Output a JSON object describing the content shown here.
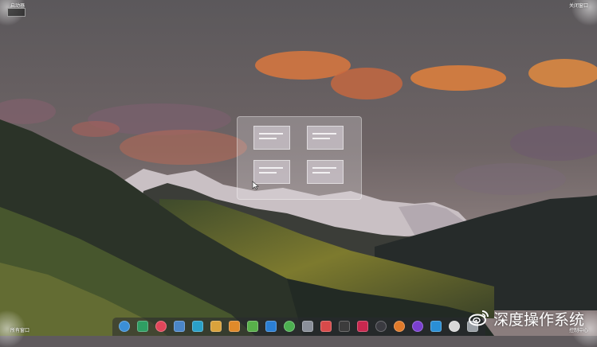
{
  "corners": {
    "top_left": "启动器",
    "top_right": "关闭窗口",
    "bottom_left": "所有窗口",
    "bottom_right": "控制中心"
  },
  "watermark": {
    "text": "深度操作系统"
  },
  "dock": {
    "icons": [
      {
        "name": "launcher-icon",
        "color": "#3b8fd6"
      },
      {
        "name": "terminal-icon",
        "color": "#2f9e63"
      },
      {
        "name": "music-icon",
        "color": "#e0465a"
      },
      {
        "name": "files-icon",
        "color": "#4a86c8"
      },
      {
        "name": "store-icon",
        "color": "#2aa0c8"
      },
      {
        "name": "archive-icon",
        "color": "#d9a23c"
      },
      {
        "name": "shop-icon",
        "color": "#e08a2a"
      },
      {
        "name": "text-editor-icon",
        "color": "#58b04a"
      },
      {
        "name": "editor-icon",
        "color": "#2b7fd4"
      },
      {
        "name": "chrome-icon",
        "color": "#4caf50"
      },
      {
        "name": "settings-gear-icon",
        "color": "#8a8f99"
      },
      {
        "name": "presentation-icon",
        "color": "#d84a4a"
      },
      {
        "name": "code-icon",
        "color": "#3c3c3c"
      },
      {
        "name": "screenshot-icon",
        "color": "#c8284f"
      },
      {
        "name": "system-monitor-icon",
        "color": "#3a3a40"
      },
      {
        "name": "backup-icon",
        "color": "#e07a2a"
      },
      {
        "name": "power-icon",
        "color": "#7a3fd0"
      },
      {
        "name": "camera-icon",
        "color": "#2a8fd6"
      },
      {
        "name": "notes-icon",
        "color": "#d8d8d8"
      },
      {
        "name": "trash-icon",
        "color": "#9aa0a6"
      }
    ]
  },
  "colors": {
    "sky": "#5e5a5d",
    "cloud_orange": "#e07a3e",
    "hills_dark": "#2a3028",
    "hills_lit": "#8a8a32"
  }
}
